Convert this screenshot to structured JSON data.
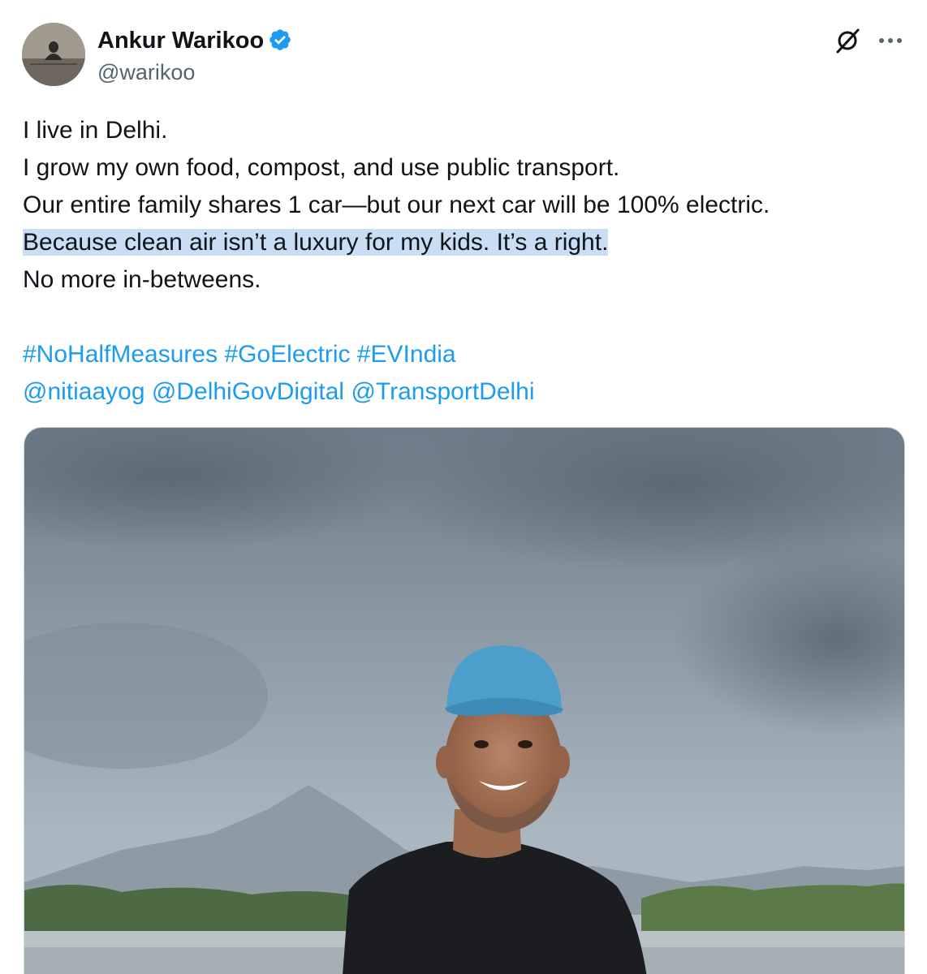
{
  "tweet": {
    "author": {
      "name": "Ankur Warikoo",
      "handle": "@warikoo",
      "verified": true,
      "avatar_icon": "avatar-image"
    },
    "header_icons": {
      "grok": "grok-icon",
      "more": "more-options-icon"
    },
    "lines": [
      "I live in Delhi.",
      "I grow my own food, compost, and use public transport.",
      "Our entire family shares 1 car—but our next car will be 100% electric.",
      "Because clean air isn’t a luxury for my kids. It’s a right.",
      "No more in-betweens."
    ],
    "hashtags": [
      "#NoHalfMeasures",
      "#GoElectric",
      "#EVIndia"
    ],
    "mentions": [
      "@nitiaayog",
      "@DelhiGovDigital",
      "@TransportDelhi"
    ],
    "media_icon": "photo-image"
  },
  "colors": {
    "link": "#1d9bf0",
    "verified_badge": "#1d9bf0",
    "text_highlight": "#c9ddf4",
    "handle": "#536471"
  }
}
